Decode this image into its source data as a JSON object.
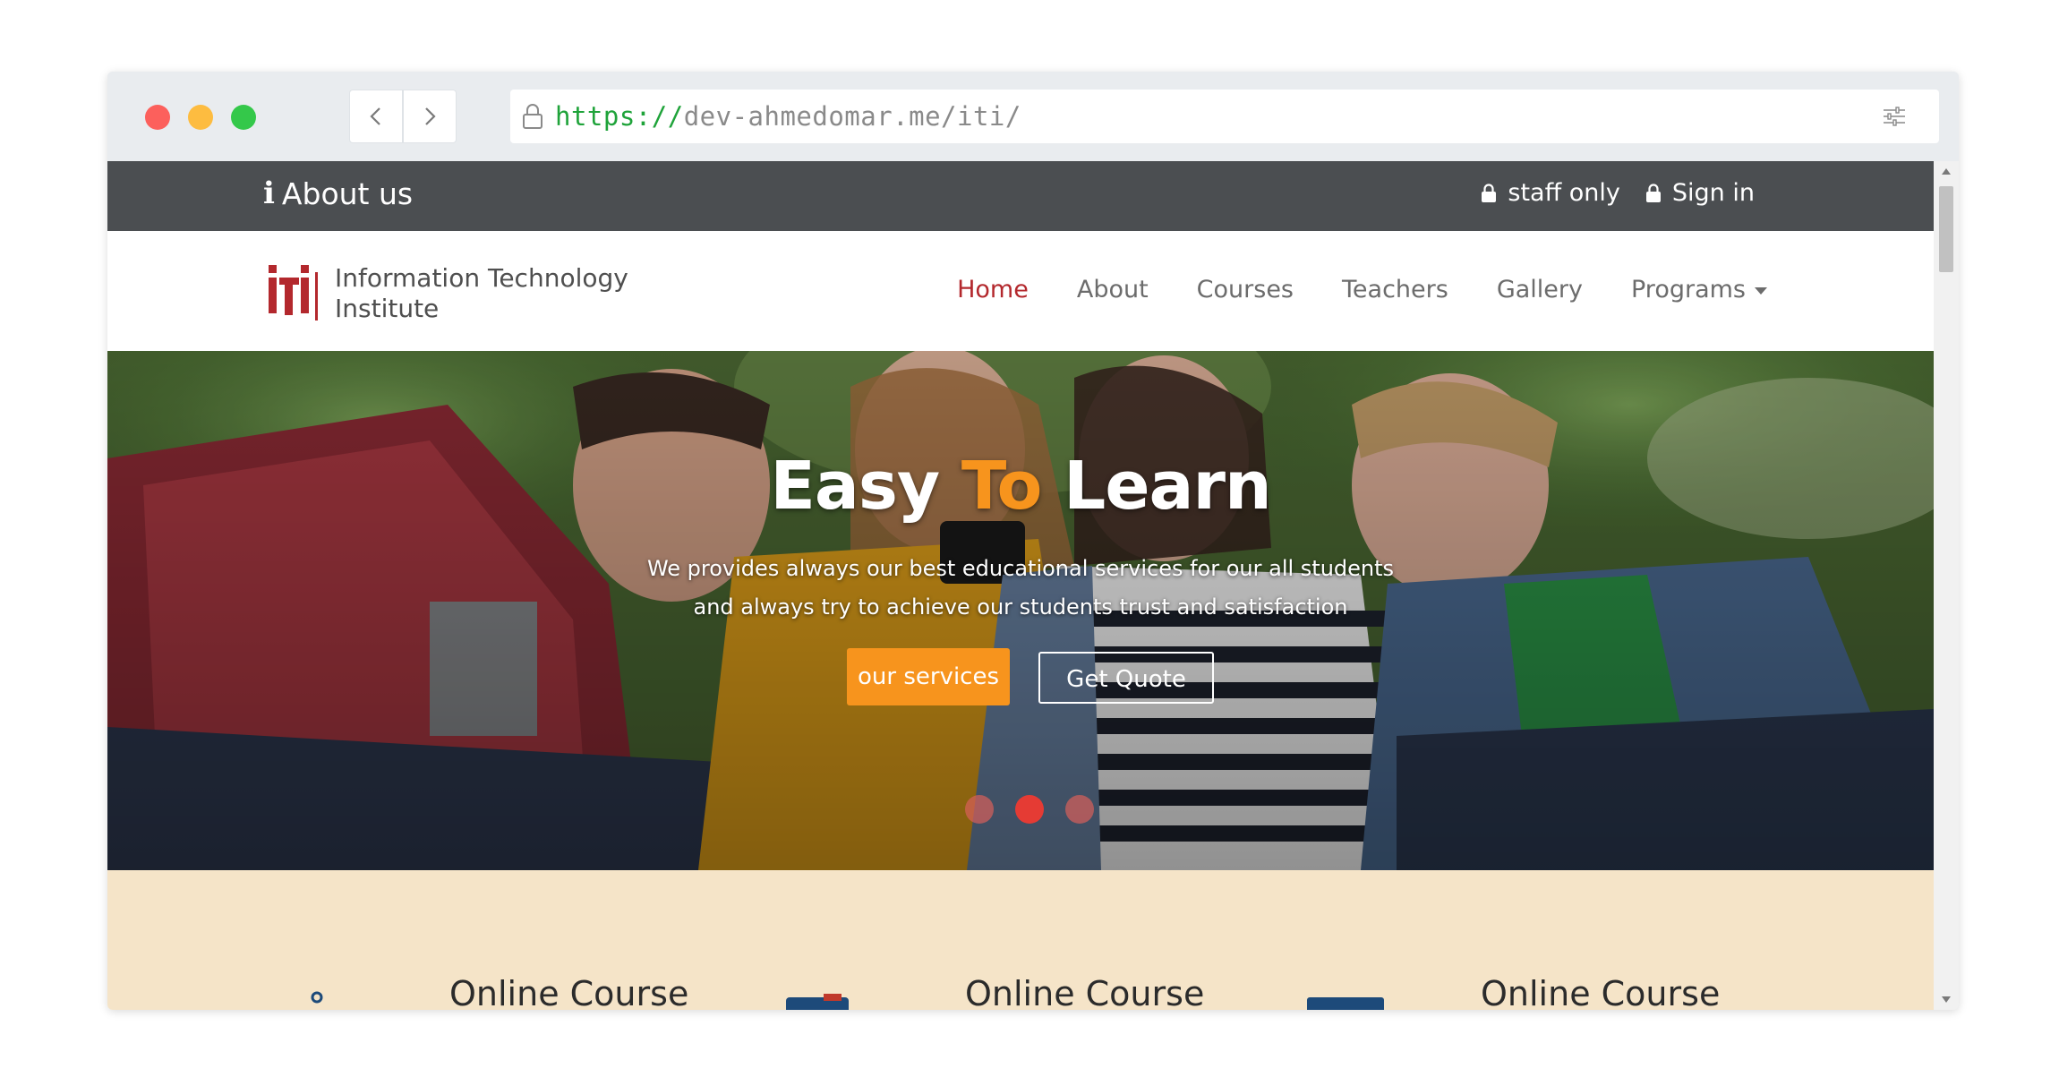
{
  "browser": {
    "url_scheme": "https://",
    "url_rest": "dev-ahmedomar.me/iti/",
    "icons": [
      "chevron-left-icon",
      "chevron-right-icon",
      "lock-icon",
      "sliders-icon"
    ]
  },
  "topbar": {
    "about_label": "About us",
    "staff_label": "staff only",
    "signin_label": "Sign in"
  },
  "navbar": {
    "logo_line1": "Information Technology",
    "logo_line2": "Institute",
    "menu": [
      {
        "label": "Home",
        "active": true
      },
      {
        "label": "About",
        "active": false
      },
      {
        "label": "Courses",
        "active": false
      },
      {
        "label": "Teachers",
        "active": false
      },
      {
        "label": "Gallery",
        "active": false
      },
      {
        "label": "Programs",
        "active": false,
        "dropdown": true
      }
    ]
  },
  "hero": {
    "title_part1": "Easy",
    "title_accent": "To",
    "title_part2": "Learn",
    "subtitle_line1": "We provides always our best educational services for our all students",
    "subtitle_line2": "and always try to achieve our students trust and satisfaction",
    "primary_button": "our services",
    "secondary_button": "Get Quote",
    "slides": 3,
    "active_slide": 2
  },
  "features": [
    {
      "title": "Online Course"
    },
    {
      "title": "Online Course"
    },
    {
      "title": "Online Course"
    }
  ],
  "colors": {
    "accent_orange": "#f7941d",
    "brand_red": "#b3282d",
    "topbar_bg": "#4b4e51",
    "features_bg": "#f5e4c8"
  }
}
